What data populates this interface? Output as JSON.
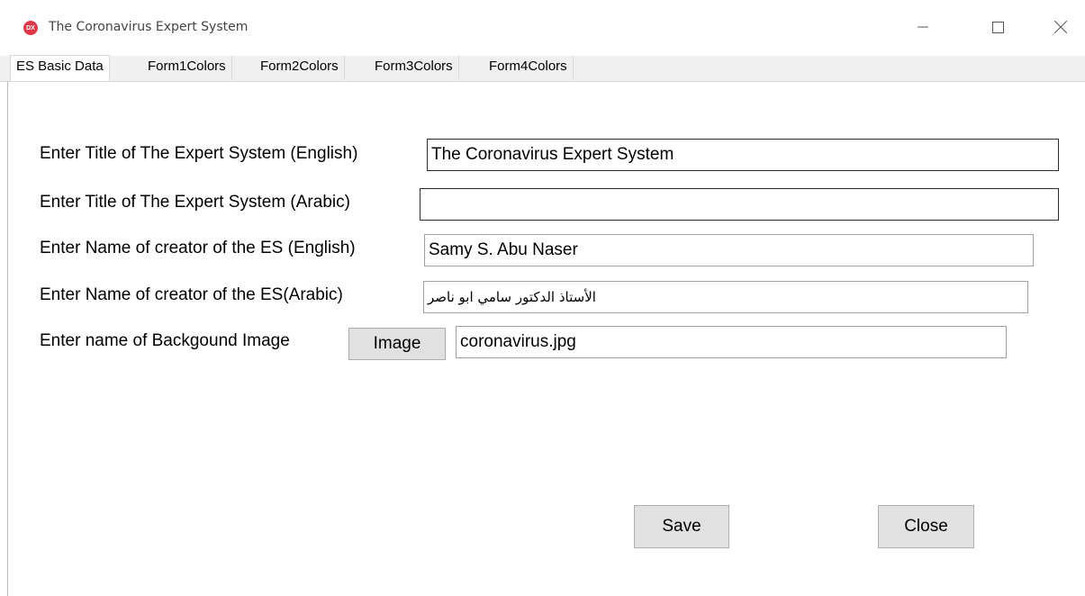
{
  "window": {
    "title": "The Coronavirus Expert System",
    "icon_text": "DX"
  },
  "tabs": [
    {
      "label": "ES Basic Data",
      "active": true
    },
    {
      "label": "Form1Colors"
    },
    {
      "label": "Form2Colors"
    },
    {
      "label": "Form3Colors"
    },
    {
      "label": "Form4Colors"
    }
  ],
  "form": {
    "title_english": {
      "label": "Enter Title of The Expert System (English)",
      "value": "The Coronavirus Expert System"
    },
    "title_arabic": {
      "label": "Enter Title of The Expert System (Arabic)",
      "value": ""
    },
    "creator_english": {
      "label": "Enter Name of creator of the ES (English)",
      "value": "Samy S. Abu Naser"
    },
    "creator_arabic": {
      "label": "Enter Name of creator of the ES(Arabic)",
      "value": "الأستاذ الدكتور سامي ابو ناصر"
    },
    "background_image": {
      "label": "Enter name of Backgound Image",
      "button_label": "Image",
      "value": "coronavirus.jpg"
    }
  },
  "buttons": {
    "save_label": "Save",
    "close_label": "Close"
  },
  "colors": {
    "app_icon": "#e0384a",
    "button_face": "#e1e1e1",
    "tabstrip": "#f0f0f0"
  }
}
